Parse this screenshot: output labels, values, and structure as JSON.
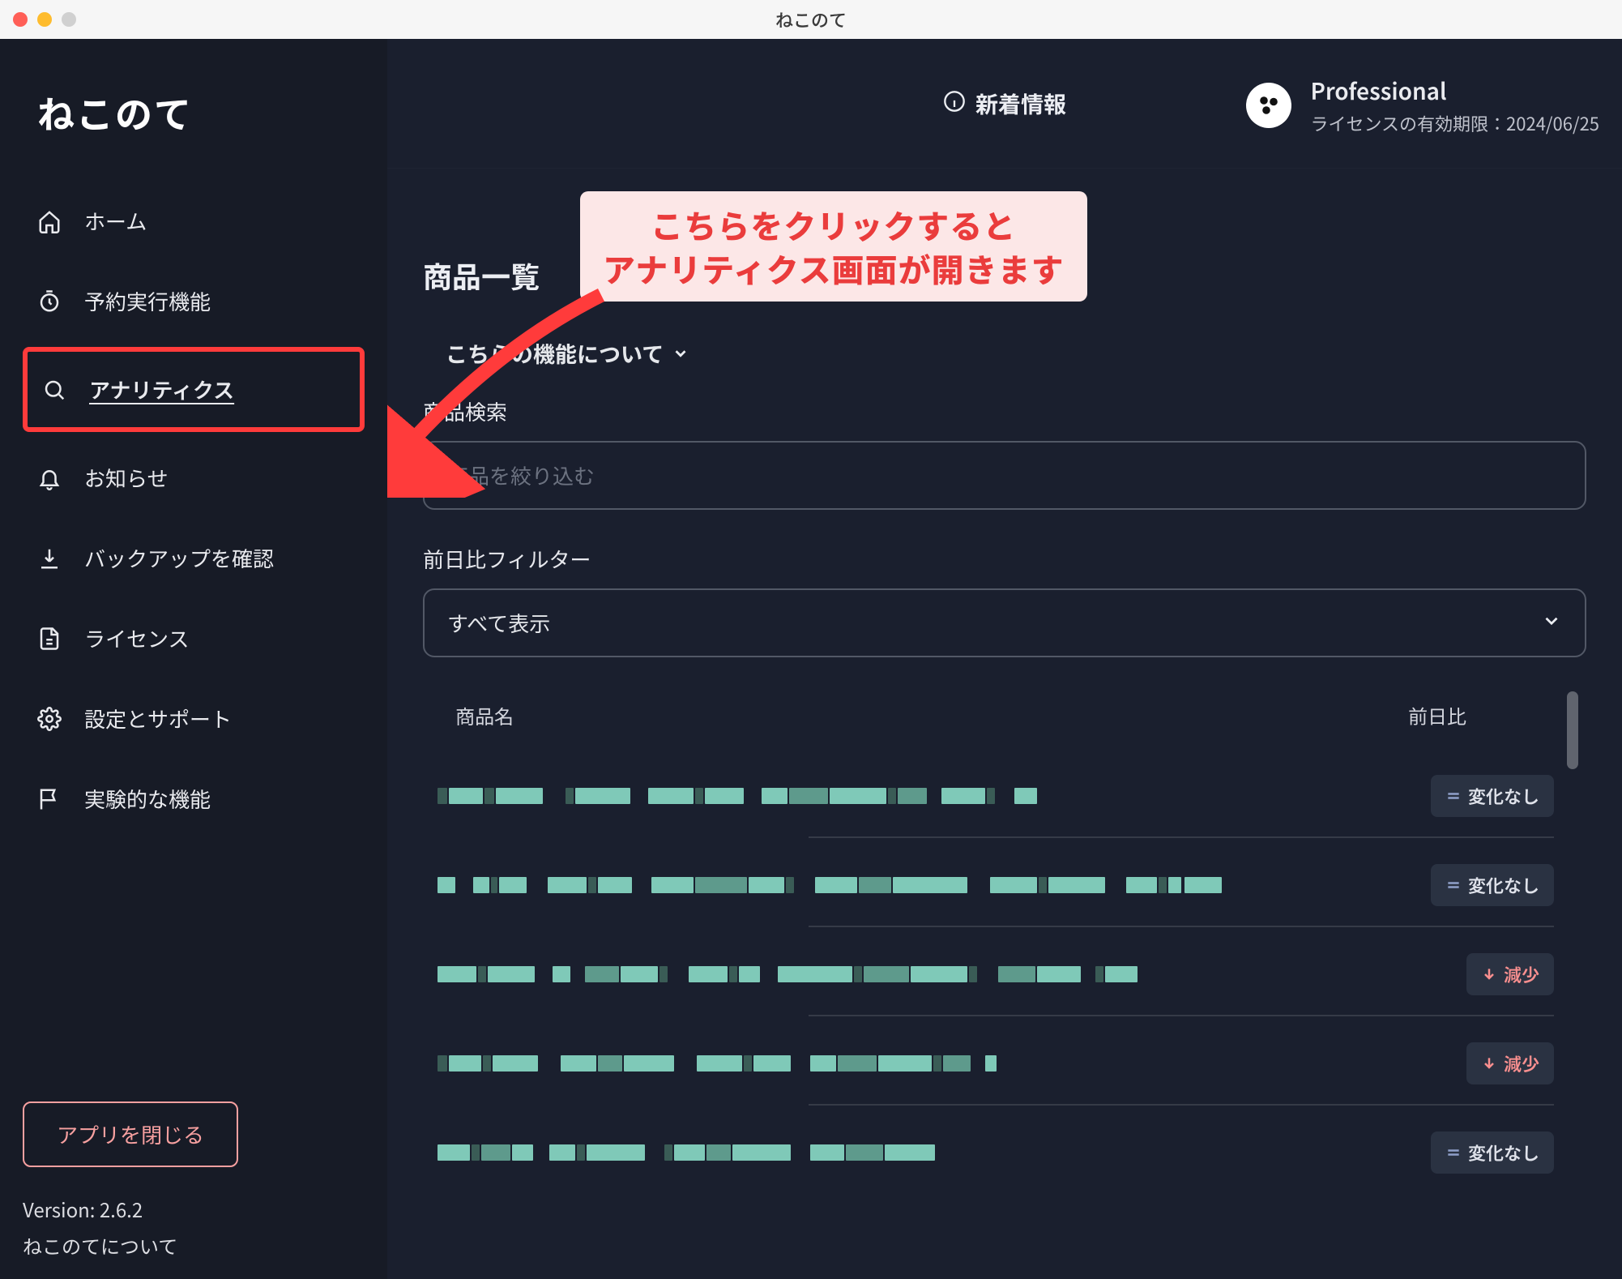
{
  "window": {
    "title": "ねこのて"
  },
  "logo": "ねこのて",
  "sidebar": {
    "items": [
      {
        "label": "ホーム"
      },
      {
        "label": "予約実行機能"
      },
      {
        "label": "アナリティクス"
      },
      {
        "label": "お知らせ"
      },
      {
        "label": "バックアップを確認"
      },
      {
        "label": "ライセンス"
      },
      {
        "label": "設定とサポート"
      },
      {
        "label": "実験的な機能"
      }
    ],
    "close_label": "アプリを閉じる",
    "version": "Version: 2.6.2",
    "about": "ねこのてについて"
  },
  "topbar": {
    "news_label": "新着情報",
    "license_tier": "Professional",
    "license_expiry": "ライセンスの有効期限：2024/06/25"
  },
  "annotation": {
    "line1": "こちらをクリックすると",
    "line2": "アナリティクス画面が開きます"
  },
  "page": {
    "title": "商品一覧",
    "about_feature": "こちらの機能について",
    "search_label": "商品検索",
    "search_placeholder": "商品を絞り込む",
    "filter_label": "前日比フィルター",
    "filter_selected": "すべて表示"
  },
  "table": {
    "col_name": "商品名",
    "col_change": "前日比",
    "badges": {
      "no_change": "変化なし",
      "decrease": "減少"
    },
    "rows": [
      {
        "change": "no_change"
      },
      {
        "change": "no_change"
      },
      {
        "change": "decrease"
      },
      {
        "change": "decrease"
      },
      {
        "change": "no_change"
      }
    ]
  }
}
